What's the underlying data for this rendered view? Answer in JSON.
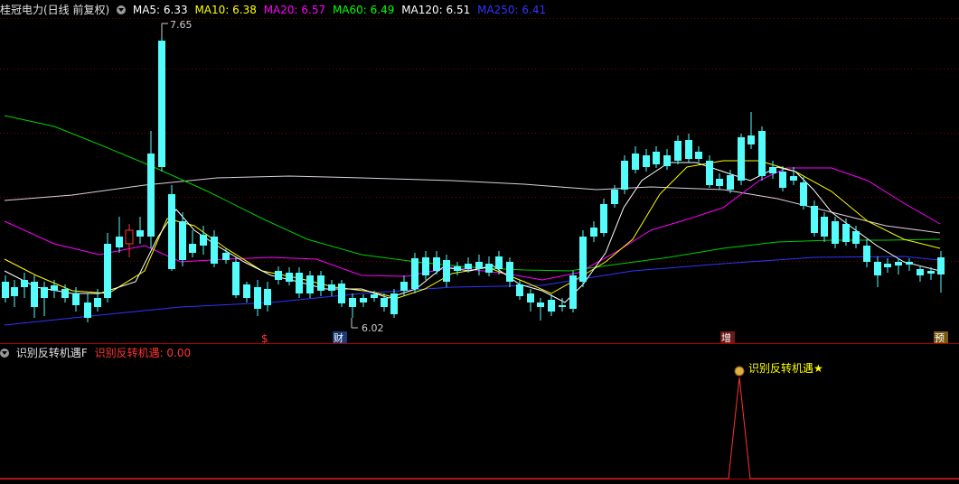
{
  "stock": {
    "title": "桂冠电力(日线 前复权)"
  },
  "ma_legend": [
    {
      "label": "MA5: 6.33",
      "color": "#ffffff"
    },
    {
      "label": "MA10: 6.38",
      "color": "#ffff00"
    },
    {
      "label": "MA20: 6.57",
      "color": "#ff00ff"
    },
    {
      "label": "MA60: 6.49",
      "color": "#00ff00"
    },
    {
      "label": "MA120: 6.51",
      "color": "#ffffff"
    },
    {
      "label": "MA250: 6.41",
      "color": "#3333ff"
    }
  ],
  "price_labels": {
    "high": "7.65",
    "low": "6.02"
  },
  "event_markers": {
    "s": "$",
    "cai": "财",
    "zeng": "增",
    "yu": "预"
  },
  "indicator": {
    "title": "识别反转机遇F",
    "value_label": "识别反转机遇: 0.00",
    "signal_text": "识别反转机遇★"
  },
  "colors": {
    "up": "#ff3232",
    "down": "#54fcfc",
    "grid": "#7a0000",
    "bg": "#000000"
  }
}
